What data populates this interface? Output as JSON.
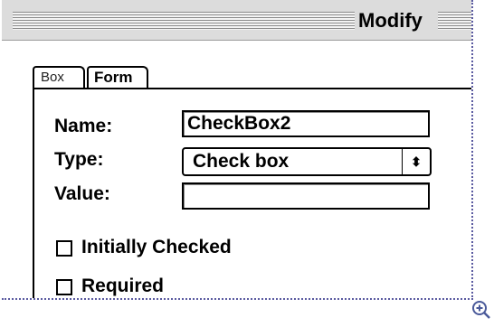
{
  "window": {
    "title": "Modify"
  },
  "tabs": [
    {
      "label": "Box"
    },
    {
      "label": "Form"
    }
  ],
  "form": {
    "name_label": "Name:",
    "name_value": "CheckBox2",
    "type_label": "Type:",
    "type_value": "Check box",
    "value_label": "Value:",
    "value_value": ""
  },
  "checkboxes": [
    {
      "label": "Initially Checked",
      "checked": false
    },
    {
      "label": "Required",
      "checked": false
    }
  ],
  "icons": {
    "zoom": "zoom-in-icon"
  }
}
